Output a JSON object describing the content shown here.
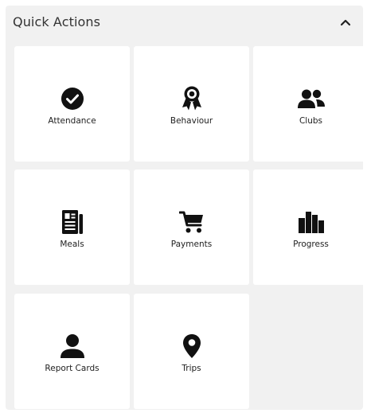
{
  "quick_actions": {
    "title": "Quick Actions",
    "toggle_icon": "chevron-up-icon",
    "items": [
      {
        "label": "Attendance",
        "icon": "check-circle-icon"
      },
      {
        "label": "Behaviour",
        "icon": "award-icon"
      },
      {
        "label": "Clubs",
        "icon": "users-icon"
      },
      {
        "label": "Meals",
        "icon": "newspaper-icon"
      },
      {
        "label": "Payments",
        "icon": "cart-icon"
      },
      {
        "label": "Progress",
        "icon": "bar-chart-icon"
      },
      {
        "label": "Report Cards",
        "icon": "person-icon"
      },
      {
        "label": "Trips",
        "icon": "map-pin-icon"
      }
    ]
  },
  "colors": {
    "panel_background": "#f1f1f1",
    "tile_background": "#ffffff",
    "icon": "#111111"
  }
}
